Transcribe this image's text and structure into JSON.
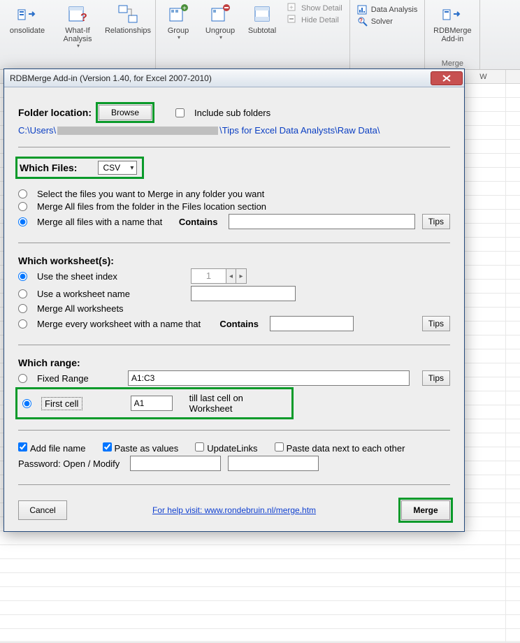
{
  "ribbon": {
    "buttons": {
      "consolidate": "onsolidate",
      "whatif": "What-If\nAnalysis",
      "relationships": "Relationships",
      "group": "Group",
      "ungroup": "Ungroup",
      "subtotal": "Subtotal",
      "showdetail": "Show Detail",
      "hidedetail": "Hide Detail",
      "dataanalysis": "Data Analysis",
      "solver": "Solver",
      "rdbmerge": "RDBMerge\nAdd-in"
    },
    "groups": {
      "merge": "Merge"
    }
  },
  "sheet": {
    "col": "W"
  },
  "dialog": {
    "title": "RDBMerge Add-in (Version 1.40, for Excel 2007-2010)",
    "folder": {
      "label": "Folder location:",
      "browse": "Browse",
      "includesub": "Include sub folders",
      "path_prefix": "C:\\Users\\",
      "path_suffix": "\\Tips for Excel Data Analysts\\Raw Data\\"
    },
    "files": {
      "label": "Which Files:",
      "filetype": "CSV",
      "opt_select": "Select the files you want to Merge in any folder you want",
      "opt_all": "Merge All files from the folder in the Files location section",
      "opt_name": "Merge all files with a name that",
      "contains": "Contains",
      "tips": "Tips"
    },
    "ws": {
      "label": "Which worksheet(s):",
      "use_index": "Use the sheet index",
      "index_val": "1",
      "use_name": "Use a worksheet name",
      "merge_all": "Merge All worksheets",
      "merge_name": "Merge every worksheet with a name that",
      "contains": "Contains",
      "tips": "Tips"
    },
    "range": {
      "label": "Which range:",
      "fixed": "Fixed Range",
      "fixed_val": "A1:C3",
      "tips": "Tips",
      "firstcell": "First cell",
      "firstcell_val": "A1",
      "till": "till last cell on Worksheet"
    },
    "opts": {
      "addfile": "Add file name",
      "pastevals": "Paste as values",
      "updatelinks": "UpdateLinks",
      "pastenext": "Paste data next to each other",
      "pwlabel": "Password: Open / Modify"
    },
    "footer": {
      "cancel": "Cancel",
      "help": "For help visit: www.rondebruin.nl/merge.htm",
      "merge": "Merge"
    }
  }
}
